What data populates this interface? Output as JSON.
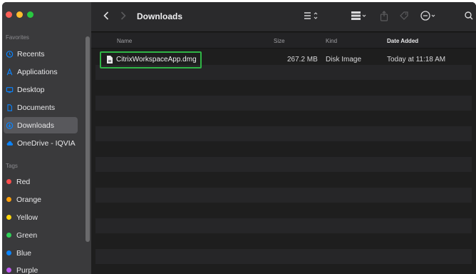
{
  "sidebar": {
    "favorites_label": "Favorites",
    "items": [
      {
        "label": "Recents",
        "icon": "clock-icon"
      },
      {
        "label": "Applications",
        "icon": "applications-icon"
      },
      {
        "label": "Desktop",
        "icon": "desktop-icon"
      },
      {
        "label": "Documents",
        "icon": "document-icon"
      },
      {
        "label": "Downloads",
        "icon": "download-icon",
        "selected": true
      },
      {
        "label": "OneDrive - IQVIA",
        "icon": "cloud-icon"
      }
    ],
    "tags_label": "Tags",
    "tags": [
      {
        "label": "Red",
        "color": "#ff4d4d"
      },
      {
        "label": "Orange",
        "color": "#ff9f0a"
      },
      {
        "label": "Yellow",
        "color": "#ffd60a"
      },
      {
        "label": "Green",
        "color": "#30d158"
      },
      {
        "label": "Blue",
        "color": "#0a84ff"
      },
      {
        "label": "Purple",
        "color": "#bf5af2"
      }
    ]
  },
  "toolbar": {
    "title": "Downloads"
  },
  "columns": {
    "name": "Name",
    "size": "Size",
    "kind": "Kind",
    "date_added": "Date Added"
  },
  "file": {
    "name": "CitrixWorkspaceApp.dmg",
    "size": "267.2 MB",
    "kind": "Disk Image",
    "date_added": "Today at 11:18 AM",
    "highlight_color": "#2fb545"
  }
}
